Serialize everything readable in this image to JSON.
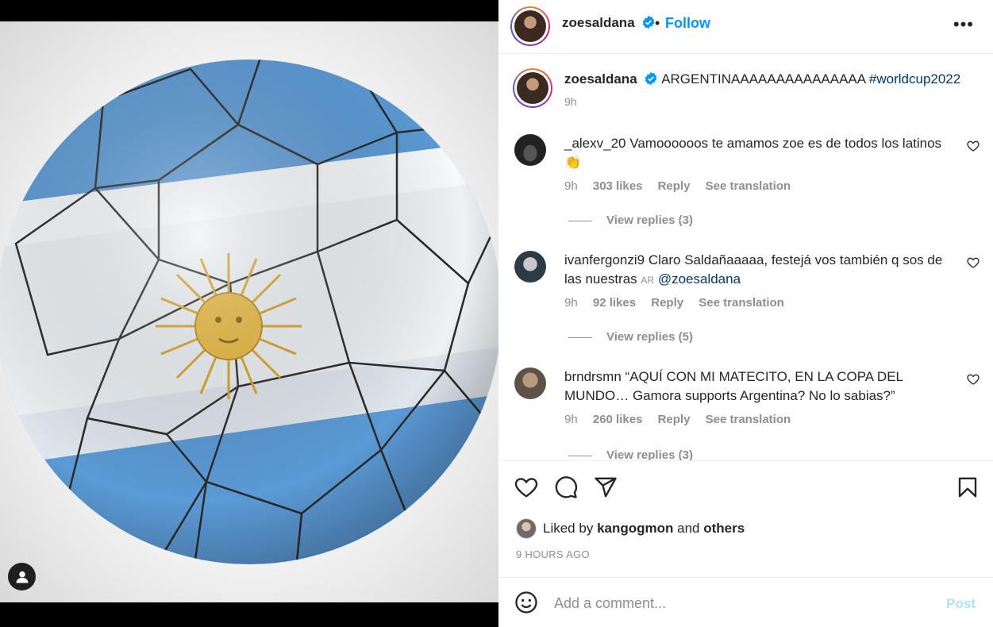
{
  "post": {
    "username": "zoesaldana",
    "follow_label": "Follow",
    "dot": "•",
    "more_label": "•••",
    "caption_text": "ARGENTINAAAAAAAAAAAAAAA",
    "caption_hashtag": "#worldcup2022",
    "caption_time": "9h"
  },
  "comments": [
    {
      "username": "_alexv_20",
      "text": "Vamoooooos te amamos zoe es de todos los latinos",
      "emoji": "👏",
      "time": "9h",
      "likes": "303 likes",
      "reply": "Reply",
      "translation": "See translation",
      "view_replies": "View replies (3)"
    },
    {
      "username": "ivanfergonzi9",
      "text": "Claro Saldañaaaaa, festejá vos también q sos de las nuestras",
      "flag": "AR",
      "mention": "@zoesaldana",
      "time": "9h",
      "likes": "92 likes",
      "reply": "Reply",
      "translation": "See translation",
      "view_replies": "View replies (5)"
    },
    {
      "username": "brndrsmn",
      "text": "“AQUÍ CON MI MATECITO, EN LA COPA DEL MUNDO… Gamora supports Argentina? No lo sabias?”",
      "time": "9h",
      "likes": "260 likes",
      "reply": "Reply",
      "translation": "See translation",
      "view_replies": "View replies (3)"
    }
  ],
  "likes_bar": {
    "liked_by": "Liked by",
    "liker": "kangogmon",
    "and": "and",
    "others": "others",
    "timestamp": "9 HOURS AGO"
  },
  "add_comment": {
    "placeholder": "Add a comment...",
    "post_label": "Post"
  },
  "colors": {
    "accent": "#0095f6",
    "post_disabled": "#b2dffc",
    "hashtag": "#00376b",
    "flag_blue": "#6aa7dc"
  }
}
